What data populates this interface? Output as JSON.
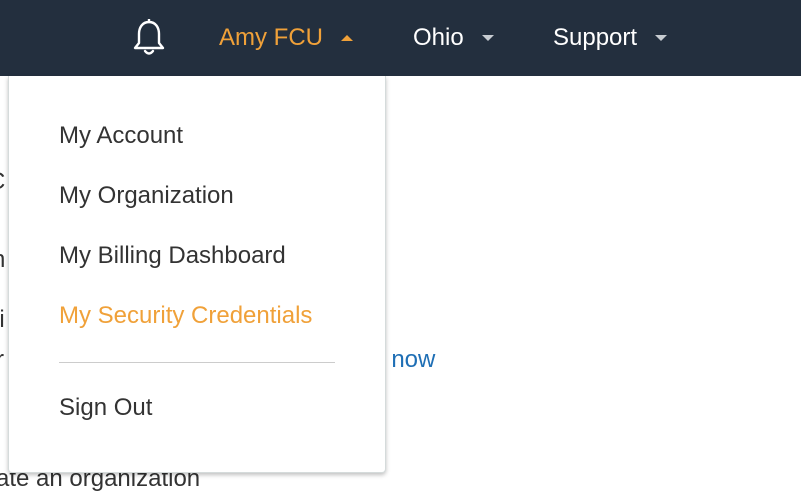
{
  "colors": {
    "topbar_bg": "#232f3e",
    "accent": "#f0a139",
    "link": "#1f6fb5",
    "text": "#333333"
  },
  "header": {
    "notifications_icon": "bell-icon",
    "account_label": "Amy FCU",
    "region_label": "Ohio",
    "support_label": "Support"
  },
  "account_menu": {
    "items": [
      {
        "label": "My Account"
      },
      {
        "label": "My Organization"
      },
      {
        "label": "My Billing Dashboard"
      },
      {
        "label": "My Security Credentials",
        "active": true
      }
    ],
    "sign_out_label": "Sign Out"
  },
  "background": {
    "fragment_1": "C",
    "fragment_2": "n",
    "fragment_3": "hi",
    "fragment_4": "r",
    "link_fragment": "rt now",
    "bottom_fragment": "ate an organization"
  }
}
